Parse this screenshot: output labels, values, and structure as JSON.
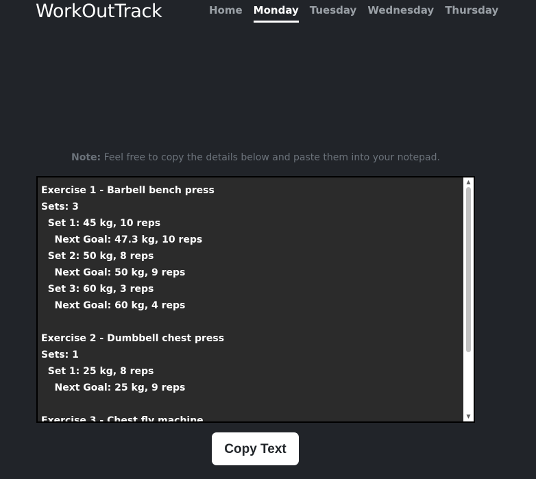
{
  "header": {
    "brand": "WorkOutTrack",
    "nav": [
      {
        "label": "Home",
        "active": false
      },
      {
        "label": "Monday",
        "active": true
      },
      {
        "label": "Tuesday",
        "active": false
      },
      {
        "label": "Wednesday",
        "active": false
      },
      {
        "label": "Thursday",
        "active": false
      }
    ]
  },
  "note": {
    "label": "Note:",
    "text": " Feel free to copy the details below and paste them into your notepad."
  },
  "details": {
    "text": "Exercise 1 - Barbell bench press\nSets: 3\n  Set 1: 45 kg, 10 reps\n    Next Goal: 47.3 kg, 10 reps\n  Set 2: 50 kg, 8 reps\n    Next Goal: 50 kg, 9 reps\n  Set 3: 60 kg, 3 reps\n    Next Goal: 60 kg, 4 reps\n\nExercise 2 - Dumbbell chest press\nSets: 1\n  Set 1: 25 kg, 8 reps\n    Next Goal: 25 kg, 9 reps\n\nExercise 3 - Chest fly machine"
  },
  "actions": {
    "copy_label": "Copy Text"
  },
  "icons": {
    "scroll_up": "scroll-up-arrow-icon",
    "scroll_down": "scroll-down-arrow-icon"
  },
  "colors": {
    "background": "#212429",
    "active_nav": "#ffffff",
    "inactive_nav": "#9aa0a6",
    "textarea_bg": "#2b2b2b"
  }
}
